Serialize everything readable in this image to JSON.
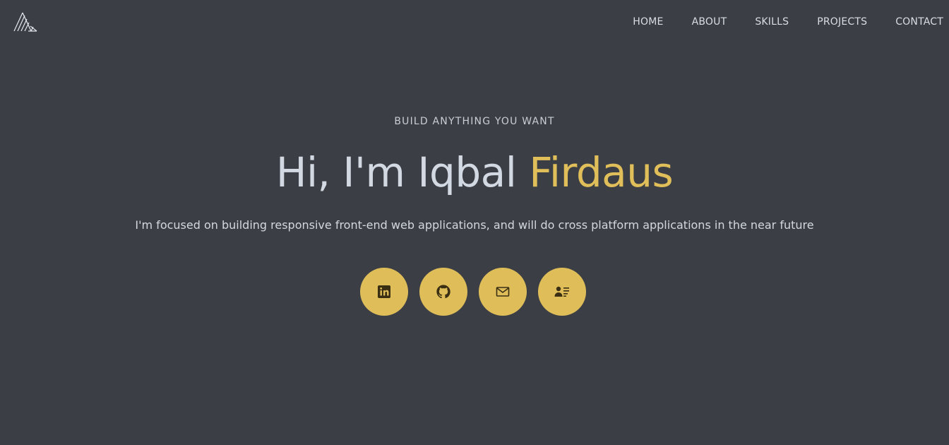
{
  "nav": {
    "items": [
      {
        "label": "HOME"
      },
      {
        "label": "ABOUT"
      },
      {
        "label": "SKILLS"
      },
      {
        "label": "PROJECTS"
      },
      {
        "label": "CONTACT"
      }
    ]
  },
  "hero": {
    "eyebrow": "BUILD ANYTHING YOU WANT",
    "headline_prefix": "Hi, I'm Iqbal ",
    "headline_accent": "Firdaus",
    "tagline": "I'm focused on building responsive front-end web applications, and will do cross platform applications in the near future"
  },
  "socials": [
    {
      "icon": "linkedin-icon"
    },
    {
      "icon": "github-icon"
    },
    {
      "icon": "mail-icon"
    },
    {
      "icon": "contact-card-icon"
    }
  ],
  "colors": {
    "background": "#3b3e44",
    "accent": "#e0bf5a",
    "text": "#d3d9e2",
    "icon_dark": "#3a2f12"
  }
}
